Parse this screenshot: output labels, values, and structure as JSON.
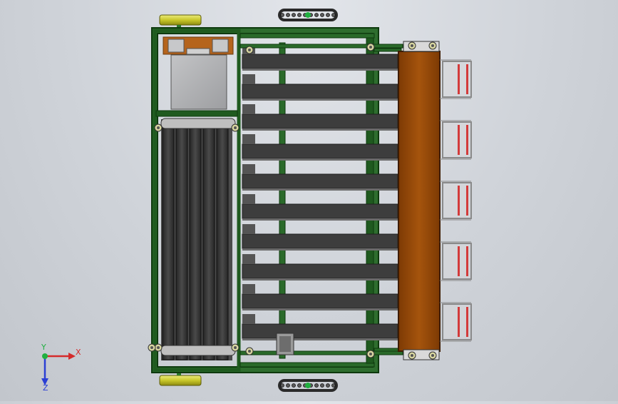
{
  "viewport": {
    "background": "#cfd3d9",
    "colors": {
      "frame": "#1f5a1f",
      "frame_dark": "#0e3a0e",
      "slat": "#3c3c3c",
      "slat_light": "#5a5a5a",
      "belt": "#2f2f2f",
      "plate": "#a9aaac",
      "bracket": "#b5641c",
      "tray": "#9a4a08",
      "roller": "#d2d032",
      "fin": "#d33a3a",
      "chain": "#2a2a2a"
    }
  },
  "triad": {
    "x_label": "X",
    "y_label": "Y",
    "z_label": "Z",
    "x_color": "#d42b2b",
    "y_color": "#20b040",
    "z_color": "#2b3fd4"
  }
}
